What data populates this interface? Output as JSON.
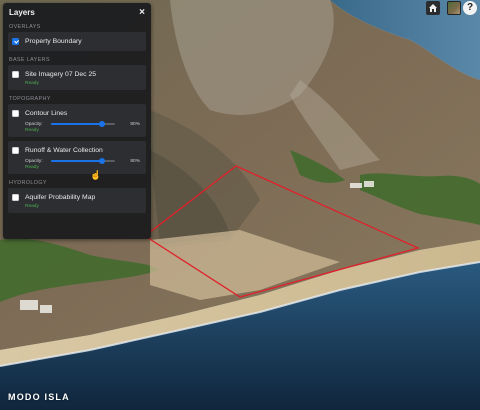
{
  "panel": {
    "title": "Layers",
    "close_icon": "close-icon",
    "sections": {
      "overlays": "OVERLAYS",
      "base_layers": "BASE LAYERS",
      "topography": "TOPOGRAPHY",
      "hydrology": "HYDROLOGY"
    },
    "layers": {
      "property_boundary": {
        "label": "Property Boundary",
        "checked": true
      },
      "site_imagery": {
        "label": "Site Imagery 07 Dec 25",
        "checked": false,
        "status": "Ready"
      },
      "contour_lines": {
        "label": "Contour Lines",
        "checked": false,
        "opacity_label": "Opacity:",
        "opacity_value": "80%",
        "opacity": 0.8,
        "status": "Ready"
      },
      "runoff": {
        "label": "Runoff & Water Collection",
        "checked": false,
        "opacity_label": "Opacity:",
        "opacity_value": "80%",
        "opacity": 0.8,
        "status": "Ready"
      },
      "aquifer": {
        "label": "Aquifer Probability Map",
        "checked": false,
        "status": "Ready"
      }
    }
  },
  "toolbar": {
    "home_icon": "home-icon",
    "basemap_icon": "basemap-thumbnail-icon",
    "help_label": "?"
  },
  "brand": {
    "text": "MODO ISLA"
  },
  "colors": {
    "boundary": "#e0202a",
    "accent": "#1a73e8",
    "ready": "#4caf50",
    "panel_bg": "#1c1d1f",
    "card_bg": "#2d2e31",
    "ocean": "#1d3a57",
    "beach": "#d7c6a0"
  }
}
